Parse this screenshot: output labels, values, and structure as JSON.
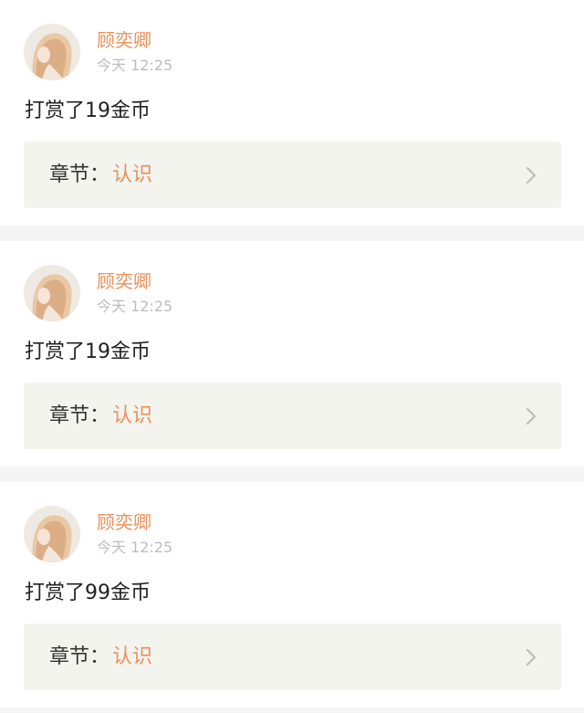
{
  "colors": {
    "accent": "#e8915c",
    "card_background": "#ffffff",
    "page_background": "#f5f5f5",
    "chapter_row_background": "#f4f4ee",
    "timestamp": "#bdbdbd"
  },
  "icons": {
    "chevron": "chevron-right-icon",
    "avatar": "user-avatar"
  },
  "posts": [
    {
      "username": "顾奕卿",
      "time": "今天 12:25",
      "message": "打赏了19金币",
      "chapter_label": "章节：",
      "chapter_name": "认识"
    },
    {
      "username": "顾奕卿",
      "time": "今天 12:25",
      "message": "打赏了19金币",
      "chapter_label": "章节：",
      "chapter_name": "认识"
    },
    {
      "username": "顾奕卿",
      "time": "今天 12:25",
      "message": "打赏了99金币",
      "chapter_label": "章节：",
      "chapter_name": "认识"
    }
  ]
}
